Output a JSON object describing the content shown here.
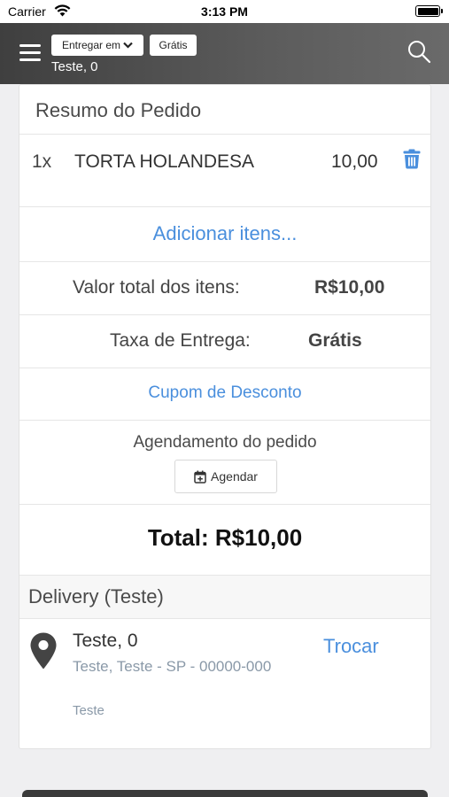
{
  "status_bar": {
    "carrier": "Carrier",
    "time": "3:13 PM"
  },
  "header": {
    "deliver_label": "Entregar em",
    "fee_badge": "Grátis",
    "address": "Teste, 0"
  },
  "summary": {
    "title": "Resumo do Pedido",
    "items": [
      {
        "qty": "1x",
        "name": "TORTA HOLANDESA",
        "price": "10,00"
      }
    ],
    "add_items": "Adicionar itens...",
    "items_total_label": "Valor total dos itens:",
    "items_total_value": "R$10,00",
    "delivery_fee_label": "Taxa de Entrega:",
    "delivery_fee_value": "Grátis",
    "coupon": "Cupom de Desconto",
    "schedule_label": "Agendamento do pedido",
    "schedule_button": "Agendar",
    "grand_total": "Total: R$10,00"
  },
  "delivery": {
    "title": "Delivery (Teste)",
    "address_line1": "Teste, 0",
    "address_line2": "Teste, Teste - SP - 00000-000",
    "address_line3": "Teste",
    "change": "Trocar"
  },
  "colors": {
    "accent": "#4a8fdd",
    "header": "#505050"
  },
  "icons": [
    "wifi-icon",
    "battery-icon",
    "menu-icon",
    "chevron-down-icon",
    "search-icon",
    "trash-icon",
    "calendar-plus-icon",
    "map-pin-icon"
  ]
}
